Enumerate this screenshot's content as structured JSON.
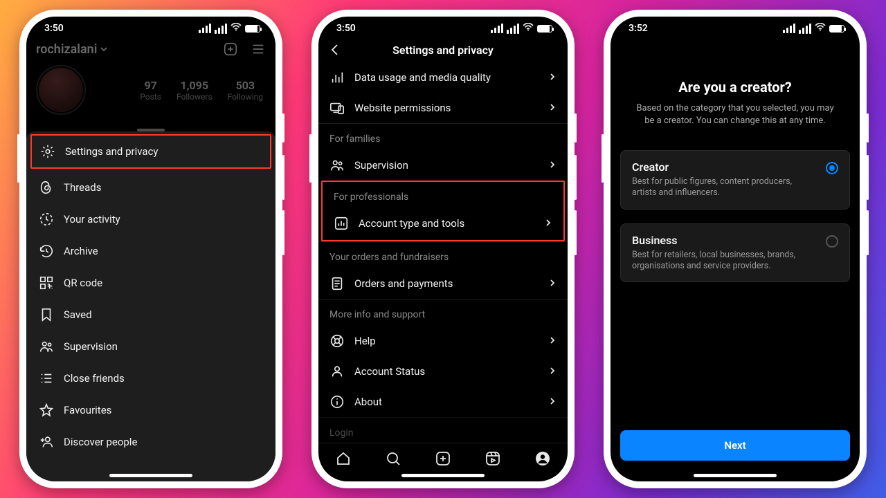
{
  "screen1": {
    "time": "3:50",
    "username": "rochizalani",
    "stats": {
      "posts": {
        "num": "97",
        "label": "Posts"
      },
      "followers": {
        "num": "1,095",
        "label": "Followers"
      },
      "following": {
        "num": "503",
        "label": "Following"
      }
    },
    "menu": {
      "settings": "Settings and privacy",
      "threads": "Threads",
      "activity": "Your activity",
      "archive": "Archive",
      "qr": "QR code",
      "saved": "Saved",
      "supervision": "Supervision",
      "close_friends": "Close friends",
      "favourites": "Favourites",
      "discover": "Discover people"
    }
  },
  "screen2": {
    "time": "3:50",
    "title": "Settings and privacy",
    "rows": {
      "data_usage": "Data usage and media quality",
      "website_perms": "Website permissions"
    },
    "sections": {
      "families": {
        "header": "For families",
        "supervision": "Supervision"
      },
      "professionals": {
        "header": "For professionals",
        "account_type": "Account type and tools"
      },
      "orders": {
        "header": "Your orders and fundraisers",
        "orders_payments": "Orders and payments"
      },
      "support": {
        "header": "More info and support",
        "help": "Help",
        "account_status": "Account Status",
        "about": "About"
      },
      "login_header": "Login"
    }
  },
  "screen3": {
    "time": "3:52",
    "heading": "Are you a creator?",
    "subtext": "Based on the category that you selected, you may be a creator. You can change this at any time.",
    "creator": {
      "title": "Creator",
      "desc": "Best for public figures, content producers, artists and influencers."
    },
    "business": {
      "title": "Business",
      "desc": "Best for retailers, local businesses, brands, organisations and service providers."
    },
    "next": "Next"
  }
}
